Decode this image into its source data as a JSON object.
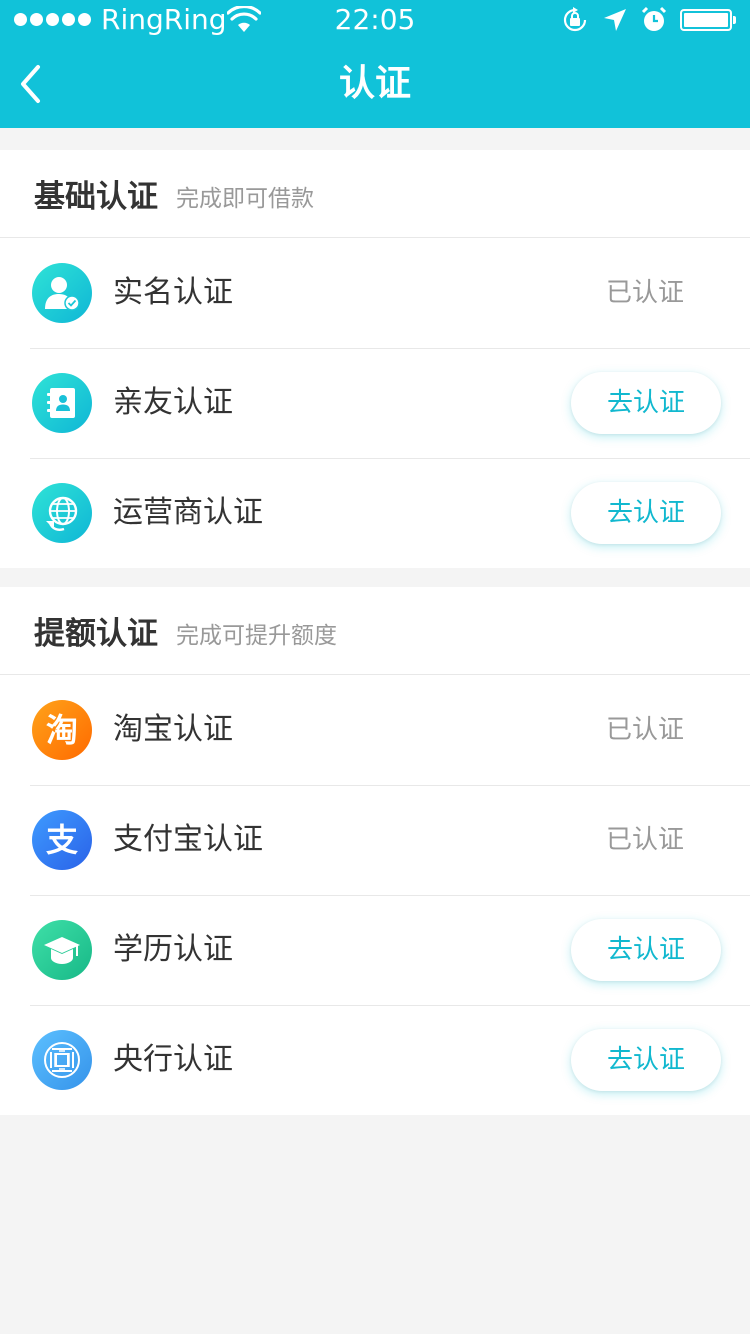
{
  "status_bar": {
    "carrier": "RingRing",
    "time": "22:05"
  },
  "nav": {
    "title": "认证"
  },
  "basic_section": {
    "title": "基础认证",
    "subtitle": "完成即可借款",
    "items": [
      {
        "label": "实名认证",
        "icon": "user-verified-icon",
        "state": "已认证"
      },
      {
        "label": "亲友认证",
        "icon": "contacts-book-icon",
        "action": "去认证"
      },
      {
        "label": "运营商认证",
        "icon": "globe-refresh-icon",
        "action": "去认证"
      }
    ]
  },
  "boost_section": {
    "title": "提额认证",
    "subtitle": "完成可提升额度",
    "items": [
      {
        "label": "淘宝认证",
        "icon": "taobao-icon",
        "icon_glyph": "淘",
        "state": "已认证"
      },
      {
        "label": "支付宝认证",
        "icon": "alipay-icon",
        "icon_glyph": "支",
        "state": "已认证"
      },
      {
        "label": "学历认证",
        "icon": "graduation-cap-icon",
        "action": "去认证"
      },
      {
        "label": "央行认证",
        "icon": "central-bank-icon",
        "action": "去认证"
      }
    ]
  },
  "colors": {
    "primary": "#11c2d9",
    "background": "#f4f4f4",
    "secondary_text": "#999999"
  }
}
